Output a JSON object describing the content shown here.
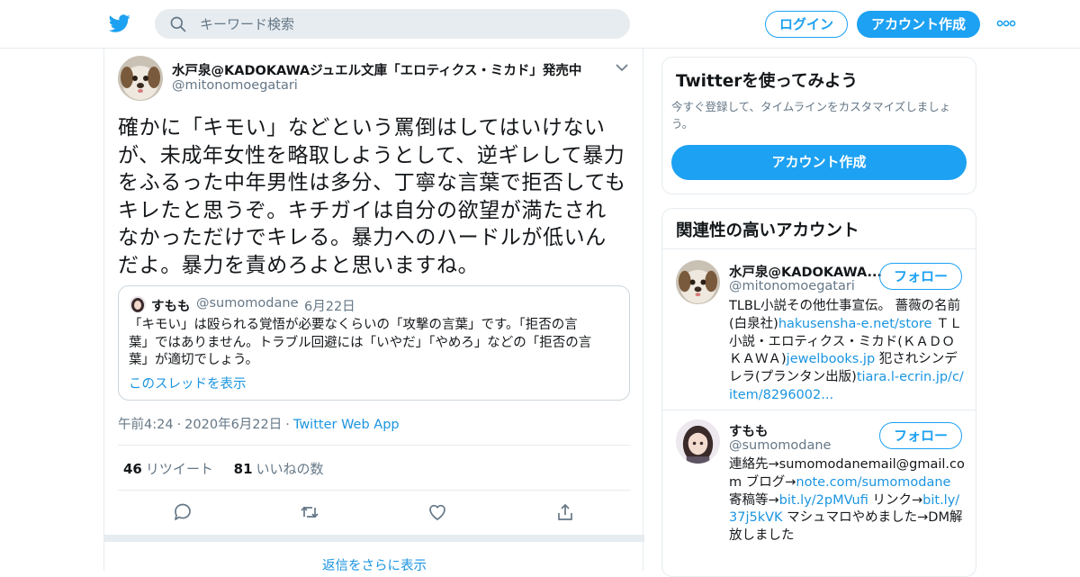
{
  "nav": {
    "search_placeholder": "キーワード検索",
    "login_label": "ログイン",
    "signup_label": "アカウント作成",
    "icons": [
      "twitter-bird-icon",
      "search-icon",
      "more-dots-icon"
    ]
  },
  "tweet": {
    "author_name": "水戸泉@KADOKAWAジュエル文庫「エロティクス・ミカド」発売中",
    "author_handle": "@mitonomoegatari",
    "text_lines": [
      "確かに「キモい」などという罵倒はしてはいけない",
      "が、未成年女性を略取しようとして、逆ギレして暴力",
      "をふるった中年男性は多分、丁寧な言葉で拒否しても",
      "キレたと思うぞ。キチガイは自分の欲望が満たされ",
      "なかっただけでキレる。暴力へのハードルが低いん",
      "だよ。暴力を責めろよと思いますね。"
    ],
    "quote": {
      "name": "すもも",
      "handle": "@sumomodane",
      "dot": "·",
      "date": "6月22日",
      "text_lines": [
        "「キモい」は殴られる覚悟が必要なくらいの「攻撃の言葉」です。「拒否の言",
        "葉」ではありません。トラブル回避には「いやだ」「やめろ」などの「拒否の言",
        "葉」が適切でしょう。"
      ],
      "thread_link": "このスレッドを表示"
    },
    "time": "午前4:24",
    "date": "2020年6月22日",
    "sep": "·",
    "source": "Twitter Web App",
    "retweet_count": "46",
    "retweet_label": "リツイート",
    "like_count": "81",
    "like_label": "いいねの数",
    "action_icons": [
      "reply-icon",
      "retweet-icon",
      "like-heart-icon",
      "share-icon"
    ],
    "more_replies": "返信をさらに表示"
  },
  "sidebar": {
    "try_title": "Twitterを使ってみよう",
    "try_desc_lines": [
      "今すぐ登録して、タイムラインをカスタマイズしましょ",
      "う。"
    ],
    "try_button": "アカウント作成",
    "related_title": "関連性の高いアカウント",
    "follow_label": "フォロー",
    "accounts": [
      {
        "name": "水戸泉@KADOKAWA...",
        "handle": "@mitonomoegatari",
        "bio": [
          {
            "t": "TLBL小説その他仕事宣伝。 薔薇の名前(白泉社)"
          },
          {
            "t": "hakusensha-e.net/store",
            "link": true
          },
          {
            "t": " ＴＬ小説・エロティクス・ミカド(ＫＡＤＯＫＡＷＡ)"
          },
          {
            "t": "jewelbooks.jp",
            "link": true
          },
          {
            "t": " 犯されシンデレラ(プランタン出版)"
          },
          {
            "t": "tiara.l-ecrin.jp/c/item/8296002...",
            "link": true
          }
        ]
      },
      {
        "name": "すもも",
        "handle": "@sumomodane",
        "bio": [
          {
            "t": "連絡先→sumomodanemail@gmail.com ブログ→"
          },
          {
            "t": "note.com/sumomodane",
            "link": true
          },
          {
            "t": " 寄稿等→"
          },
          {
            "t": "bit.ly/2pMVufi",
            "link": true
          },
          {
            "t": " リンク→"
          },
          {
            "t": "bit.ly/37j5kVK",
            "link": true
          },
          {
            "t": " マシュマロやめました→DM解放しました"
          }
        ]
      }
    ]
  },
  "colors": {
    "accent": "#1da1f2",
    "link": "#1b95e0",
    "muted": "#657786",
    "border": "#e6ecf0"
  }
}
